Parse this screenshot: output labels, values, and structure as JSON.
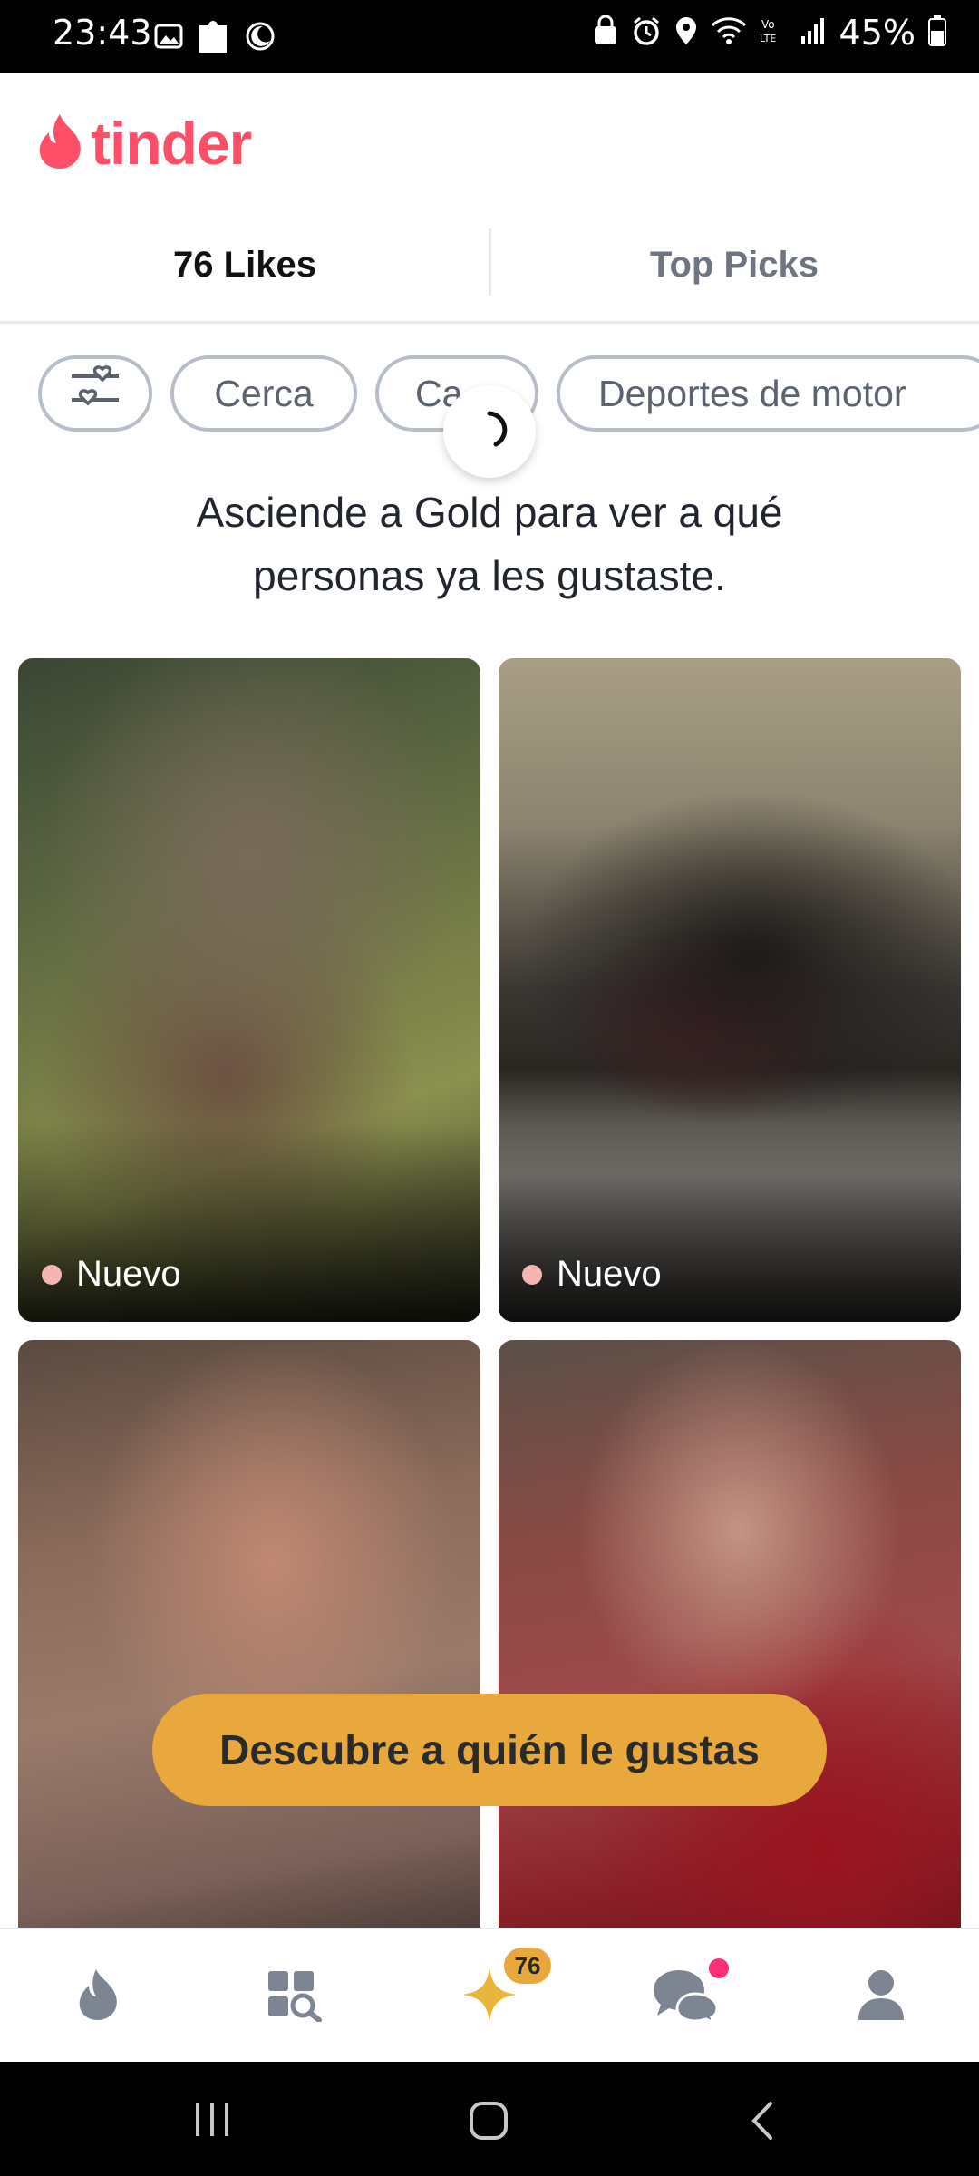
{
  "status_bar": {
    "time": "23:43",
    "battery": "45%",
    "icons_left": [
      "gallery-icon",
      "puzzle-icon",
      "moon-icon"
    ],
    "icons_right": [
      "lock-recycle-icon",
      "alarm-icon",
      "location-icon",
      "wifi-icon",
      "volte-icon",
      "signal-icon",
      "battery-icon"
    ]
  },
  "brand": {
    "name": "tinder",
    "color": "#fd5068"
  },
  "tabs": [
    {
      "label": "76 Likes",
      "active": true
    },
    {
      "label": "Top Picks",
      "active": false
    }
  ],
  "filters": {
    "chips": [
      "Cerca",
      "Ca",
      "Deportes de motor"
    ]
  },
  "promo": {
    "line1": "Asciende a Gold para ver a qué",
    "line2": "personas ya les gustaste."
  },
  "cards": [
    {
      "badge": "Nuevo"
    },
    {
      "badge": "Nuevo"
    },
    {
      "badge": ""
    },
    {
      "badge": ""
    }
  ],
  "cta": {
    "label": "Descubre a quién le gustas",
    "color": "#e8a83d"
  },
  "bottom_nav": {
    "items": [
      "flame-icon",
      "explore-icon",
      "likes-sparkle-icon",
      "chat-icon",
      "profile-icon"
    ],
    "likes_badge": "76"
  }
}
